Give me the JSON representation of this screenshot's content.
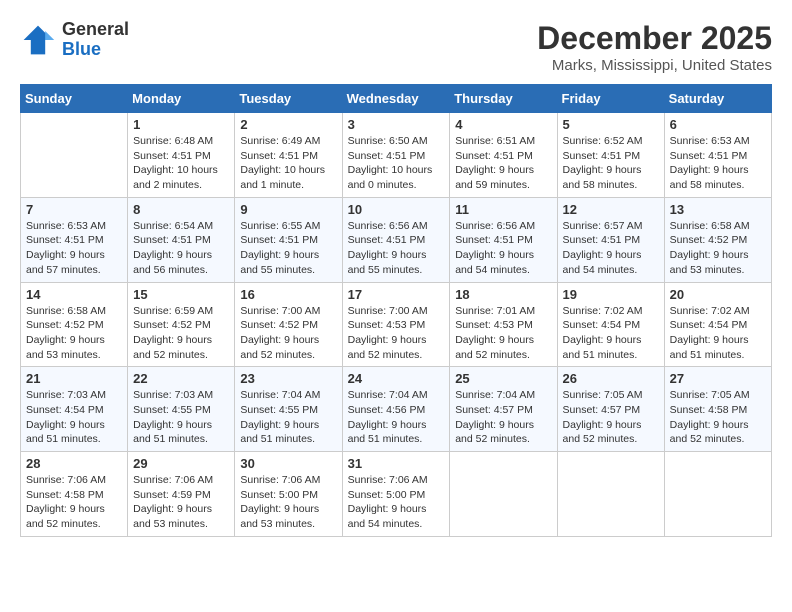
{
  "header": {
    "logo_line1": "General",
    "logo_line2": "Blue",
    "title": "December 2025",
    "subtitle": "Marks, Mississippi, United States"
  },
  "calendar": {
    "headers": [
      "Sunday",
      "Monday",
      "Tuesday",
      "Wednesday",
      "Thursday",
      "Friday",
      "Saturday"
    ],
    "weeks": [
      [
        {
          "day": "",
          "info": ""
        },
        {
          "day": "1",
          "info": "Sunrise: 6:48 AM\nSunset: 4:51 PM\nDaylight: 10 hours\nand 2 minutes."
        },
        {
          "day": "2",
          "info": "Sunrise: 6:49 AM\nSunset: 4:51 PM\nDaylight: 10 hours\nand 1 minute."
        },
        {
          "day": "3",
          "info": "Sunrise: 6:50 AM\nSunset: 4:51 PM\nDaylight: 10 hours\nand 0 minutes."
        },
        {
          "day": "4",
          "info": "Sunrise: 6:51 AM\nSunset: 4:51 PM\nDaylight: 9 hours\nand 59 minutes."
        },
        {
          "day": "5",
          "info": "Sunrise: 6:52 AM\nSunset: 4:51 PM\nDaylight: 9 hours\nand 58 minutes."
        },
        {
          "day": "6",
          "info": "Sunrise: 6:53 AM\nSunset: 4:51 PM\nDaylight: 9 hours\nand 58 minutes."
        }
      ],
      [
        {
          "day": "7",
          "info": "Sunrise: 6:53 AM\nSunset: 4:51 PM\nDaylight: 9 hours\nand 57 minutes."
        },
        {
          "day": "8",
          "info": "Sunrise: 6:54 AM\nSunset: 4:51 PM\nDaylight: 9 hours\nand 56 minutes."
        },
        {
          "day": "9",
          "info": "Sunrise: 6:55 AM\nSunset: 4:51 PM\nDaylight: 9 hours\nand 55 minutes."
        },
        {
          "day": "10",
          "info": "Sunrise: 6:56 AM\nSunset: 4:51 PM\nDaylight: 9 hours\nand 55 minutes."
        },
        {
          "day": "11",
          "info": "Sunrise: 6:56 AM\nSunset: 4:51 PM\nDaylight: 9 hours\nand 54 minutes."
        },
        {
          "day": "12",
          "info": "Sunrise: 6:57 AM\nSunset: 4:51 PM\nDaylight: 9 hours\nand 54 minutes."
        },
        {
          "day": "13",
          "info": "Sunrise: 6:58 AM\nSunset: 4:52 PM\nDaylight: 9 hours\nand 53 minutes."
        }
      ],
      [
        {
          "day": "14",
          "info": "Sunrise: 6:58 AM\nSunset: 4:52 PM\nDaylight: 9 hours\nand 53 minutes."
        },
        {
          "day": "15",
          "info": "Sunrise: 6:59 AM\nSunset: 4:52 PM\nDaylight: 9 hours\nand 52 minutes."
        },
        {
          "day": "16",
          "info": "Sunrise: 7:00 AM\nSunset: 4:52 PM\nDaylight: 9 hours\nand 52 minutes."
        },
        {
          "day": "17",
          "info": "Sunrise: 7:00 AM\nSunset: 4:53 PM\nDaylight: 9 hours\nand 52 minutes."
        },
        {
          "day": "18",
          "info": "Sunrise: 7:01 AM\nSunset: 4:53 PM\nDaylight: 9 hours\nand 52 minutes."
        },
        {
          "day": "19",
          "info": "Sunrise: 7:02 AM\nSunset: 4:54 PM\nDaylight: 9 hours\nand 51 minutes."
        },
        {
          "day": "20",
          "info": "Sunrise: 7:02 AM\nSunset: 4:54 PM\nDaylight: 9 hours\nand 51 minutes."
        }
      ],
      [
        {
          "day": "21",
          "info": "Sunrise: 7:03 AM\nSunset: 4:54 PM\nDaylight: 9 hours\nand 51 minutes."
        },
        {
          "day": "22",
          "info": "Sunrise: 7:03 AM\nSunset: 4:55 PM\nDaylight: 9 hours\nand 51 minutes."
        },
        {
          "day": "23",
          "info": "Sunrise: 7:04 AM\nSunset: 4:55 PM\nDaylight: 9 hours\nand 51 minutes."
        },
        {
          "day": "24",
          "info": "Sunrise: 7:04 AM\nSunset: 4:56 PM\nDaylight: 9 hours\nand 51 minutes."
        },
        {
          "day": "25",
          "info": "Sunrise: 7:04 AM\nSunset: 4:57 PM\nDaylight: 9 hours\nand 52 minutes."
        },
        {
          "day": "26",
          "info": "Sunrise: 7:05 AM\nSunset: 4:57 PM\nDaylight: 9 hours\nand 52 minutes."
        },
        {
          "day": "27",
          "info": "Sunrise: 7:05 AM\nSunset: 4:58 PM\nDaylight: 9 hours\nand 52 minutes."
        }
      ],
      [
        {
          "day": "28",
          "info": "Sunrise: 7:06 AM\nSunset: 4:58 PM\nDaylight: 9 hours\nand 52 minutes."
        },
        {
          "day": "29",
          "info": "Sunrise: 7:06 AM\nSunset: 4:59 PM\nDaylight: 9 hours\nand 53 minutes."
        },
        {
          "day": "30",
          "info": "Sunrise: 7:06 AM\nSunset: 5:00 PM\nDaylight: 9 hours\nand 53 minutes."
        },
        {
          "day": "31",
          "info": "Sunrise: 7:06 AM\nSunset: 5:00 PM\nDaylight: 9 hours\nand 54 minutes."
        },
        {
          "day": "",
          "info": ""
        },
        {
          "day": "",
          "info": ""
        },
        {
          "day": "",
          "info": ""
        }
      ]
    ]
  }
}
